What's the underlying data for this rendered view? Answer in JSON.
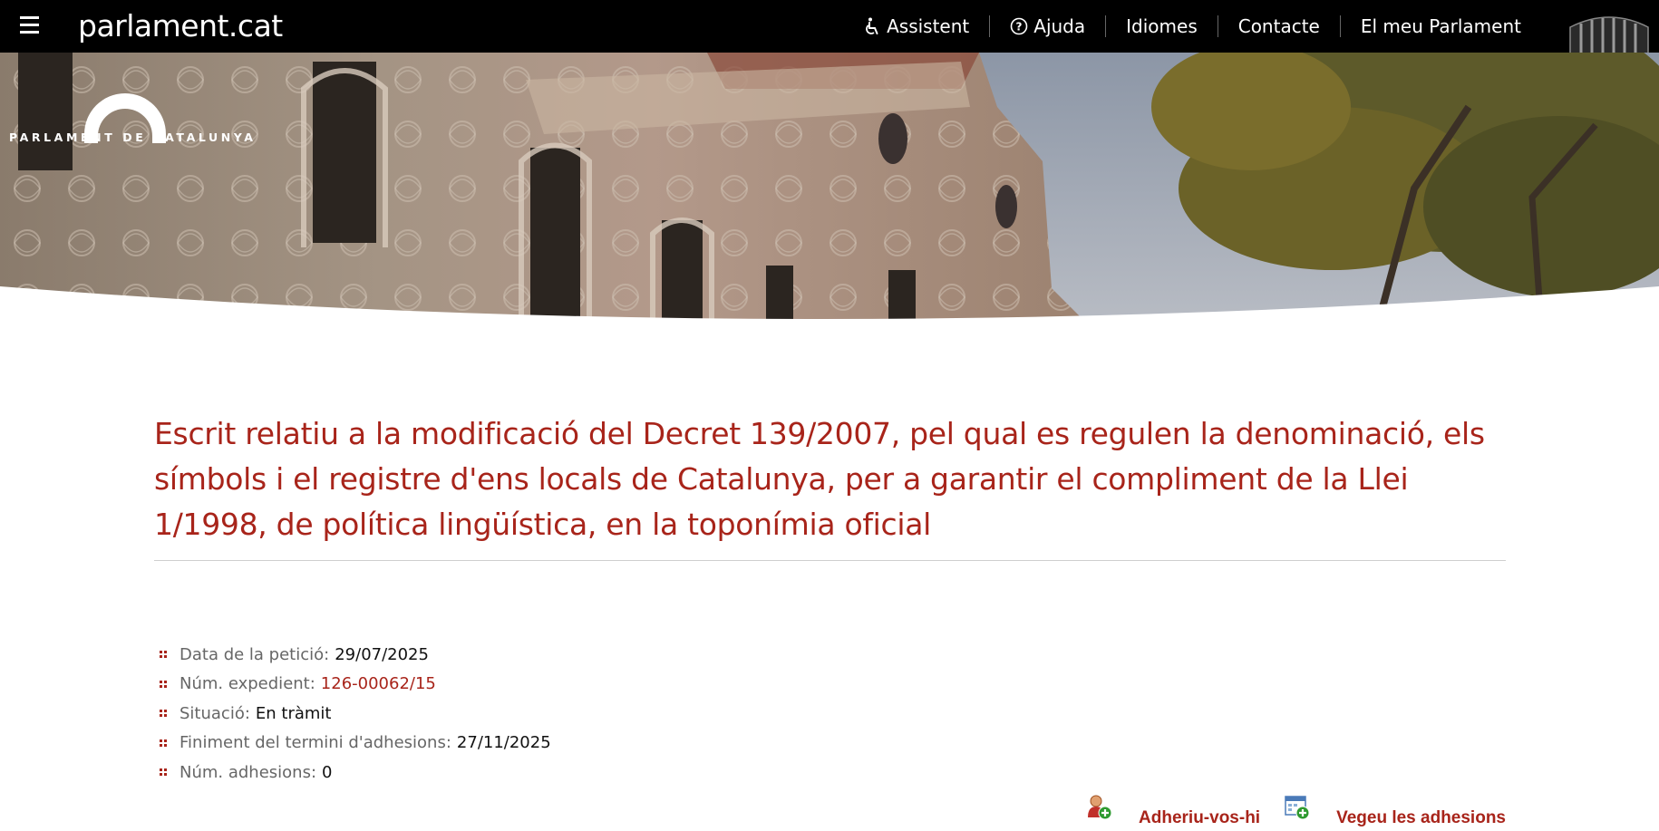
{
  "topbar": {
    "site_title": "parlament.cat",
    "nav": [
      {
        "label": "Assistent",
        "icon": "accessibility-icon"
      },
      {
        "label": "Ajuda",
        "icon": "help-circle-icon"
      },
      {
        "label": "Idiomes",
        "icon": ""
      },
      {
        "label": "Contacte",
        "icon": ""
      },
      {
        "label": "El meu Parlament",
        "icon": ""
      }
    ]
  },
  "hero": {
    "logo_text": "PARLAMENT DE CATALUNYA"
  },
  "main": {
    "title": "Escrit relatiu a la modificació del Decret 139/2007, pel qual es regulen la denominació, els símbols i el registre d'ens locals de Catalunya, per a garantir el compliment de la Llei 1/1998, de política lingüística, en la toponímia oficial",
    "details": [
      {
        "label": "Data de la petició:",
        "value": "29/07/2025"
      },
      {
        "label": "Núm. expedient:",
        "value": "126-00062/15"
      },
      {
        "label": "Situació:",
        "value": "En tràmit"
      },
      {
        "label": "Finiment del termini d'adhesions:",
        "value": "27/11/2025"
      },
      {
        "label": "Núm. adhesions:",
        "value": "0"
      }
    ],
    "actions": [
      {
        "label": "Adheriu-vos-hi",
        "icon": "add-user-icon"
      },
      {
        "label": "Vegeu les adhesions",
        "icon": "add-list-icon"
      }
    ]
  },
  "colors": {
    "accent": "#a8241a",
    "topbar_bg": "#000000"
  }
}
